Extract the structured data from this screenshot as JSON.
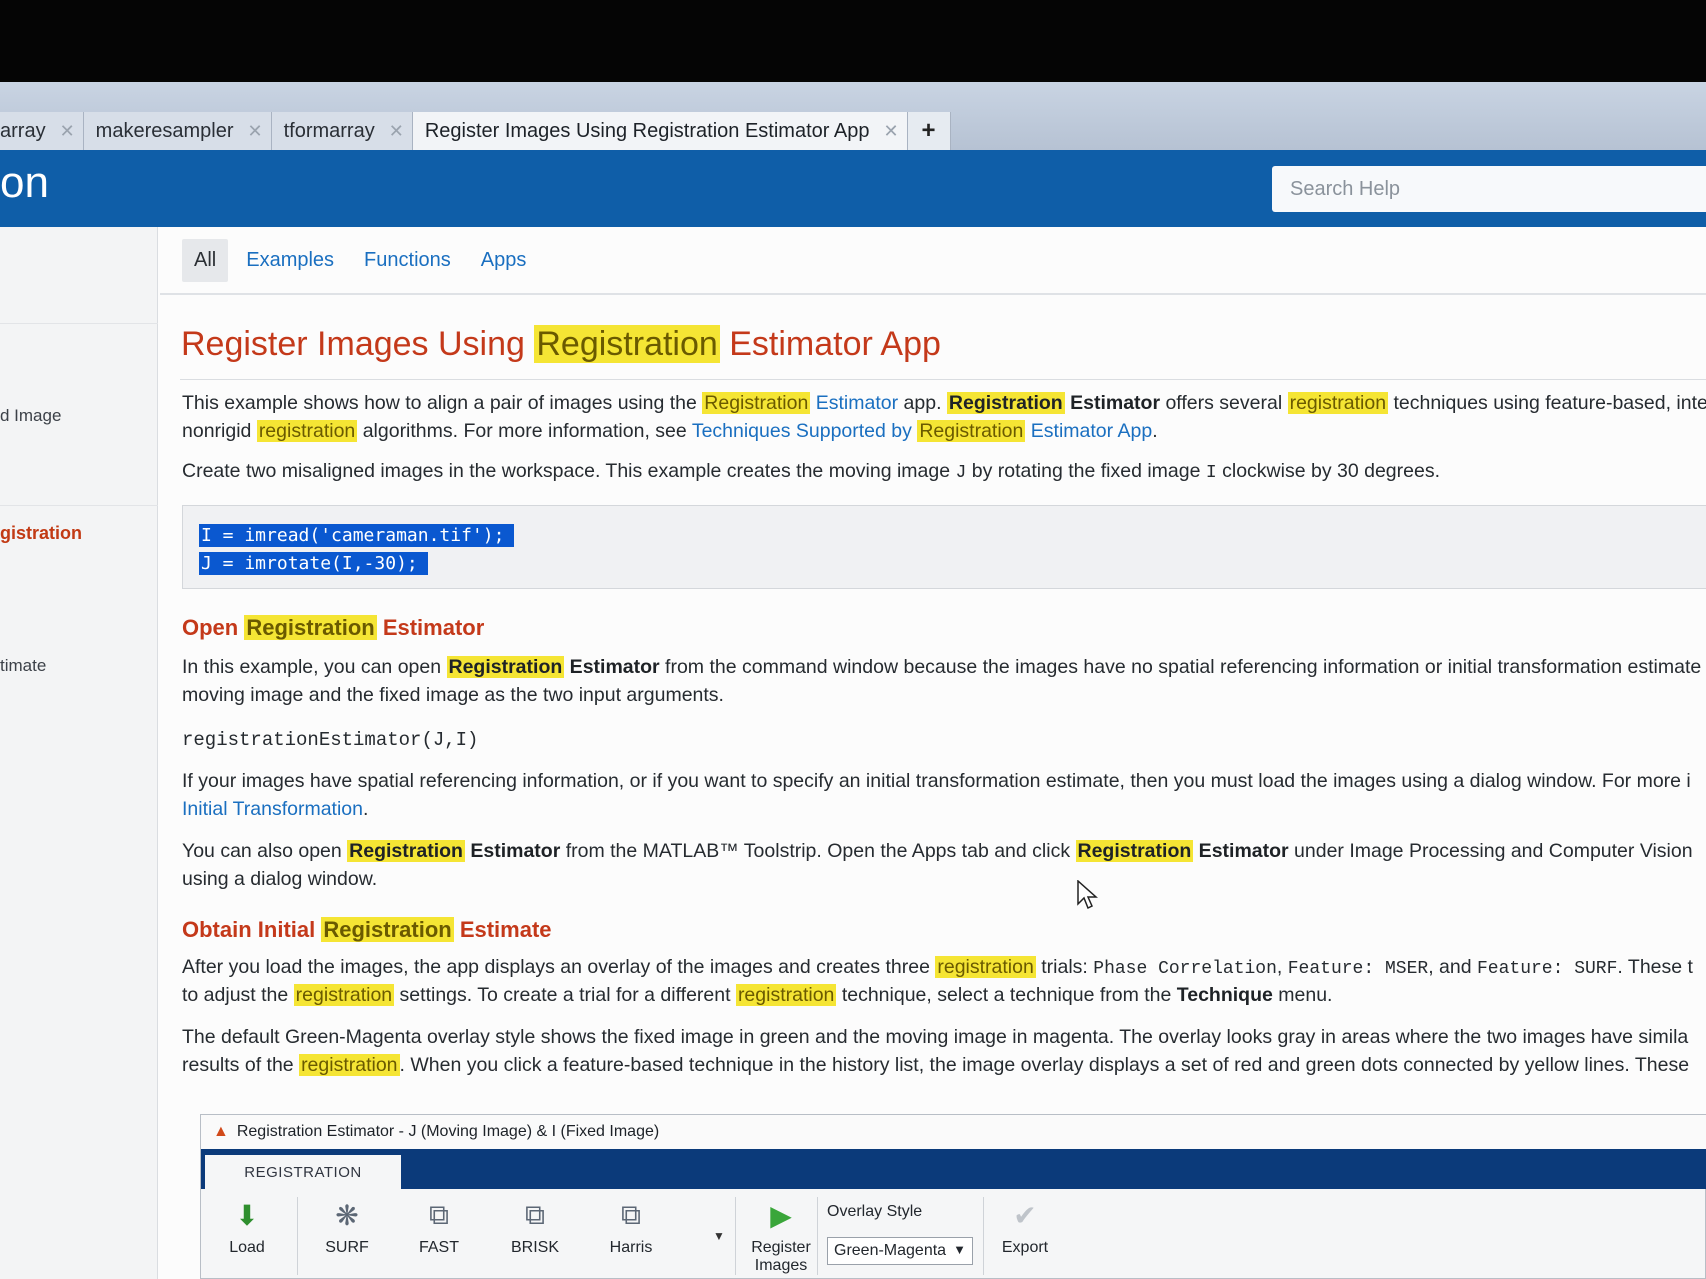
{
  "tabs": [
    {
      "label": "array"
    },
    {
      "label": "makeresampler"
    },
    {
      "label": "tformarray"
    },
    {
      "label": "Register Images Using Registration Estimator App"
    }
  ],
  "add_tab": "+",
  "tab_close": "✕",
  "header": {
    "brand": "on",
    "search_placeholder": "Search Help"
  },
  "sidebar": {
    "items": [
      "d Image",
      "gistration",
      "timate"
    ]
  },
  "filters": [
    "All",
    "Examples",
    "Functions",
    "Apps"
  ],
  "title": {
    "t1": "Register Images Using ",
    "hl": "Registration",
    "t2": " Estimator App"
  },
  "intro": {
    "a1": "This example shows how to align a pair of images using the ",
    "a_hl": "Registration",
    "a_lnk": " Estimator",
    "a2": " app. ",
    "a_b_hl": "Registration",
    "a_b": " Estimator",
    "a3": " offers several ",
    "a_hl2": "registration",
    "a4": " techniques using feature-based, inter",
    "b1": "nonrigid ",
    "b_hl": "registration",
    "b2": " algorithms. For more information, see ",
    "b_lnk1": "Techniques Supported by ",
    "b_lnk_hl": "Registration",
    "b_lnk2": " Estimator App",
    "b3": "."
  },
  "create": {
    "t1": "Create two misaligned images in the workspace. This example creates the moving image ",
    "c1": "J",
    "t2": " by rotating the fixed image ",
    "c2": "I",
    "t3": " clockwise by 30 degrees."
  },
  "code": [
    "I = imread('cameraman.tif');",
    "J = imrotate(I,-30);"
  ],
  "sec1": {
    "h_t1": "Open ",
    "h_hl": "Registration",
    "h_t2": " Estimator",
    "p1_1": "In this example, you can open ",
    "p1_hl": "Registration",
    "p1_b": " Estimator",
    "p1_2": " from the command window because the images have no spatial referencing information or initial transformation estimate",
    "p1_3": "moving image and the fixed image as the two input arguments.",
    "cmd": "registrationEstimator(J,I)",
    "p2_1": "If your images have spatial referencing information, or if you want to specify an initial transformation estimate, then you must load the images using a dialog window. For more i",
    "p2_lnk": "Initial Transformation",
    "p2_2": ".",
    "p3_1": "You can also open ",
    "p3_hl": "Registration",
    "p3_b": " Estimator",
    "p3_2": " from the MATLAB™ Toolstrip. Open the Apps tab and click ",
    "p3_hl2": "Registration",
    "p3_b2": " Estimator",
    "p3_3": " under Image Processing and Computer Vision",
    "p3_4": "using a dialog window."
  },
  "sec2": {
    "h_t1": "Obtain Initial ",
    "h_hl": "Registration",
    "h_t2": " Estimate",
    "p1_1": "After you load the images, the app displays an overlay of the images and creates three ",
    "p1_hl": "registration",
    "p1_2": " trials: ",
    "p1_c1": "Phase Correlation",
    "p1_3": ", ",
    "p1_c2": "Feature: MSER",
    "p1_4": ", and ",
    "p1_c3": "Feature: SURF",
    "p1_5": ". These t",
    "p2_1": "to adjust the ",
    "p2_hl": "registration",
    "p2_2": " settings. To create a trial for a different ",
    "p2_hl2": "registration",
    "p2_3": " technique, select a technique from the ",
    "p2_b": "Technique",
    "p2_4": " menu.",
    "p3_1": "The default Green-Magenta overlay style shows the fixed image in green and the moving image in magenta. The overlay looks gray in areas where the two images have simila",
    "p4_1": "results of the ",
    "p4_hl": "registration",
    "p4_2": ". When you click a feature-based technique in the history list, the image overlay displays a set of red and green dots connected by yellow lines. These"
  },
  "app": {
    "title": "Registration Estimator - J (Moving Image)  &  I (Fixed Image)",
    "tab": "REGISTRATION",
    "tools": [
      "Load",
      "SURF",
      "FAST",
      "BRISK",
      "Harris"
    ],
    "register_l1": "Register",
    "register_l2": "Images",
    "overlay_label": "Overlay Style",
    "overlay_value": "Green-Magenta",
    "export": "Export"
  }
}
